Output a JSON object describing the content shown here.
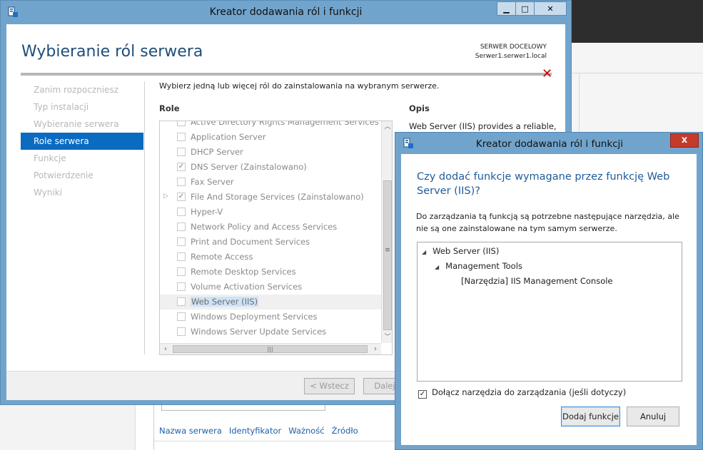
{
  "wizard": {
    "title": "Kreator dodawania ról i funkcji",
    "heading": "Wybieranie ról serwera",
    "target_label": "SERWER DOCELOWY",
    "target_server": "Serwer1.serwer1.local",
    "window_buttons": {
      "minimize": "▁",
      "maximize": "□",
      "close": "✕"
    },
    "nav": [
      {
        "label": "Zanim rozpoczniesz",
        "active": false
      },
      {
        "label": "Typ instalacji",
        "active": false
      },
      {
        "label": "Wybieranie serwera",
        "active": false
      },
      {
        "label": "Role serwera",
        "active": true
      },
      {
        "label": "Funkcje",
        "active": false
      },
      {
        "label": "Potwierdzenie",
        "active": false
      },
      {
        "label": "Wyniki",
        "active": false
      }
    ],
    "instructions": "Wybierz jedną lub więcej ról do zainstalowania na wybranym serwerze.",
    "roles_header": "Role",
    "description_header": "Opis",
    "description_text": "Web Server (IIS) provides a reliable,",
    "roles": [
      {
        "label": "Active Directory Rights Management Services",
        "checked": false,
        "partial": true
      },
      {
        "label": "Application Server",
        "checked": false
      },
      {
        "label": "DHCP Server",
        "checked": false
      },
      {
        "label": "DNS Server (Zainstalowano)",
        "checked": true
      },
      {
        "label": "Fax Server",
        "checked": false
      },
      {
        "label": "File And Storage Services (Zainstalowano)",
        "checked": true,
        "expandable": true
      },
      {
        "label": "Hyper-V",
        "checked": false
      },
      {
        "label": "Network Policy and Access Services",
        "checked": false
      },
      {
        "label": "Print and Document Services",
        "checked": false
      },
      {
        "label": "Remote Access",
        "checked": false
      },
      {
        "label": "Remote Desktop Services",
        "checked": false
      },
      {
        "label": "Volume Activation Services",
        "checked": false
      },
      {
        "label": "Web Server (IIS)",
        "checked": false,
        "selected": true
      },
      {
        "label": "Windows Deployment Services",
        "checked": false
      },
      {
        "label": "Windows Server Update Services",
        "checked": false
      }
    ],
    "buttons": {
      "back": "< Wstecz",
      "next": "Dalej"
    }
  },
  "background": {
    "columns": [
      "Nazwa serwera",
      "Identyfikator",
      "Ważność",
      "Źródło"
    ]
  },
  "dialog": {
    "title": "Kreator dodawania ról i funkcji",
    "close": "x",
    "question": "Czy dodać funkcje wymagane przez funkcję Web Server (IIS)?",
    "description": "Do zarządzania tą funkcją są potrzebne następujące narzędzia, ale nie są one zainstalowane na tym samym serwerze.",
    "tree": [
      {
        "label": "Web Server (IIS)",
        "level": 0,
        "expanded": true
      },
      {
        "label": "Management Tools",
        "level": 1,
        "expanded": true
      },
      {
        "label": "[Narzędzia] IIS Management Console",
        "level": 2,
        "expanded": false
      }
    ],
    "include_tools_label": "Dołącz narzędzia do zarządzania (jeśli dotyczy)",
    "include_tools_checked": true,
    "buttons": {
      "add": "Dodaj funkcje",
      "cancel": "Anuluj"
    }
  },
  "colors": {
    "accent": "#0a6bc1",
    "frame": "#71a4cc",
    "heading": "#1e4e79",
    "close_red": "#c43b2c"
  }
}
